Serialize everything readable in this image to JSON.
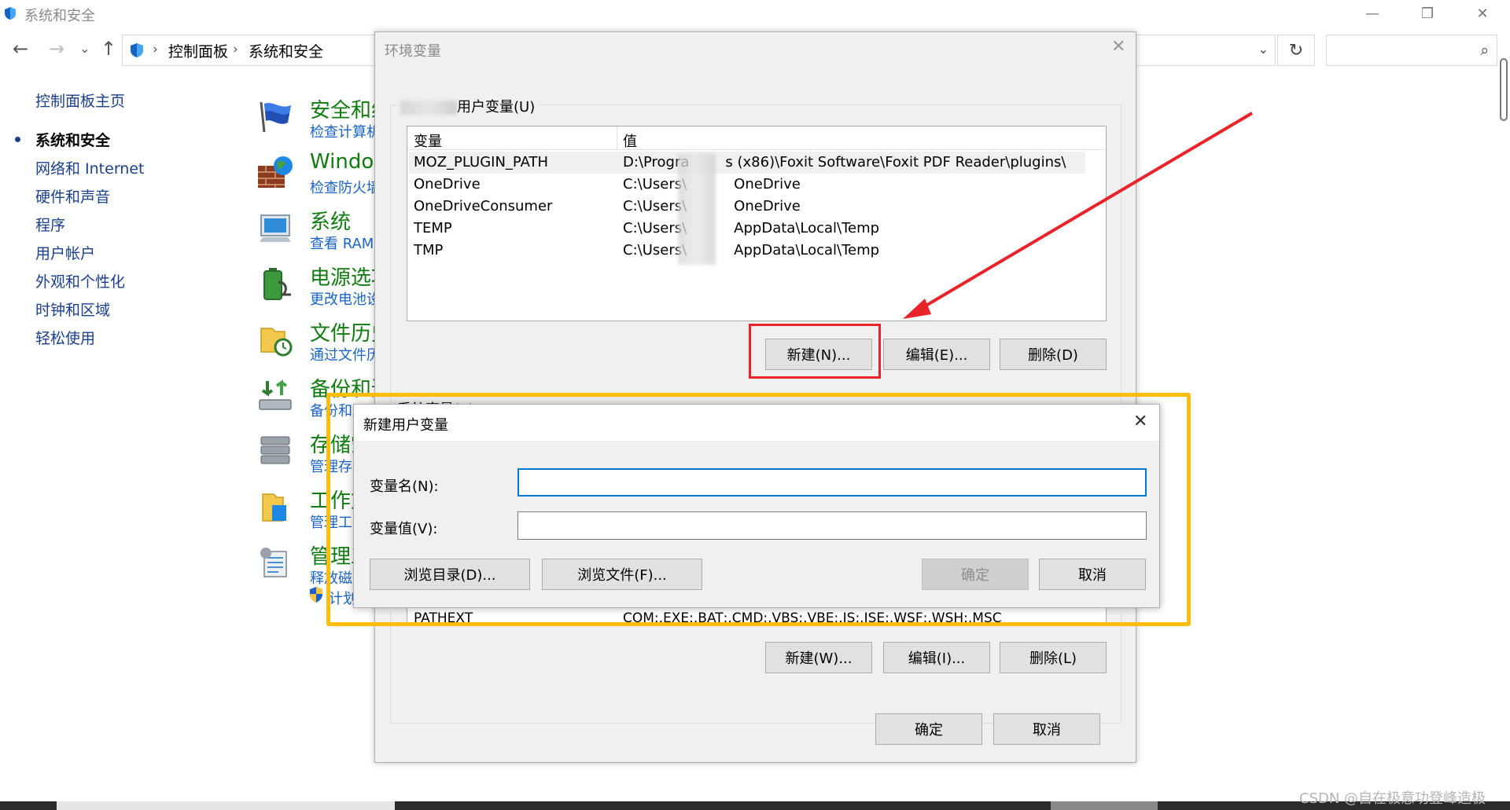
{
  "window": {
    "title": "系统和安全",
    "minimize_glyph": "—",
    "restore_glyph": "❐",
    "close_glyph": "✕"
  },
  "address": {
    "back_glyph": "←",
    "forward_glyph": "→",
    "history_glyph": "⌄",
    "up_glyph": "↑",
    "sep_glyph": "›",
    "crumbs": [
      "控制面板",
      "系统和安全"
    ],
    "dropdown_glyph": "⌄",
    "refresh_glyph": "↻",
    "search_glyph": "⌕"
  },
  "sidebar": {
    "items": [
      {
        "label": "控制面板主页"
      },
      {
        "label": "系统和安全"
      },
      {
        "label": "网络和 Internet"
      },
      {
        "label": "硬件和声音"
      },
      {
        "label": "程序"
      },
      {
        "label": "用户帐户"
      },
      {
        "label": "外观和个性化"
      },
      {
        "label": "时钟和区域"
      },
      {
        "label": "轻松使用"
      }
    ]
  },
  "categories": [
    {
      "title": "安全和维",
      "sub": "检查计算机",
      "icon": "flag-icon"
    },
    {
      "title": "Windov",
      "sub": "检查防火墙",
      "icon": "firewall-icon"
    },
    {
      "title": "系统",
      "sub": "查看 RAM",
      "icon": "monitor-icon"
    },
    {
      "title": "电源选项",
      "sub": "更改电池设",
      "icon": "battery-icon"
    },
    {
      "title": "文件历史",
      "sub": "通过文件历",
      "icon": "file-history-icon"
    },
    {
      "title": "备份和还",
      "sub": "备份和还",
      "icon": "backup-icon"
    },
    {
      "title": "存储空",
      "sub": "管理存储",
      "icon": "storage-icon"
    },
    {
      "title": "工作文",
      "sub": "管理工作",
      "icon": "work-folders-icon"
    },
    {
      "title": "管理工",
      "sub": "释放磁",
      "extra": "计划",
      "icon": "admin-tools-icon"
    }
  ],
  "env_dialog": {
    "title": "环境变量",
    "close_glyph": "✕",
    "user_group_label": "用户变量(U)",
    "columns": [
      "变量",
      "值"
    ],
    "rows": [
      {
        "name": "MOZ_PLUGIN_PATH",
        "value_a": "D:\\Progra",
        "value_b": "s (x86)\\Foxit Software\\Foxit PDF Reader\\plugins\\"
      },
      {
        "name": "OneDrive",
        "value_a": "C:\\Users\\",
        "value_b": "OneDrive"
      },
      {
        "name": "OneDriveConsumer",
        "value_a": "C:\\Users\\",
        "value_b": "OneDrive"
      },
      {
        "name": "TEMP",
        "value_a": "C:\\Users\\",
        "value_b": "AppData\\Local\\Temp"
      },
      {
        "name": "TMP",
        "value_a": "C:\\Users\\",
        "value_b": "AppData\\Local\\Temp"
      }
    ],
    "user_buttons": {
      "new": "新建(N)...",
      "edit": "编辑(E)...",
      "delete": "删除(D)"
    },
    "system_partial_label": "系统变量(S)",
    "system_partial_row": {
      "name": "PATHEXT",
      "value": "COM;.EXE;.BAT;.CMD;.VBS;.VBE;.JS;.JSE;.WSF;.WSH;.MSC"
    },
    "system_buttons": {
      "new": "新建(W)...",
      "edit": "编辑(I)...",
      "delete": "删除(L)"
    },
    "ok": "确定",
    "cancel": "取消"
  },
  "new_dialog": {
    "title": "新建用户变量",
    "close_glyph": "✕",
    "name_label": "变量名(N):",
    "value_label": "变量值(V):",
    "name_value": "",
    "value_value": "",
    "browse_dir": "浏览目录(D)...",
    "browse_file": "浏览文件(F)...",
    "ok": "确定",
    "cancel": "取消"
  },
  "annotations": {
    "red": "#e8232a",
    "orange": "#ffbc0a"
  },
  "watermark": "CSDN @自在极意功登峰造极"
}
